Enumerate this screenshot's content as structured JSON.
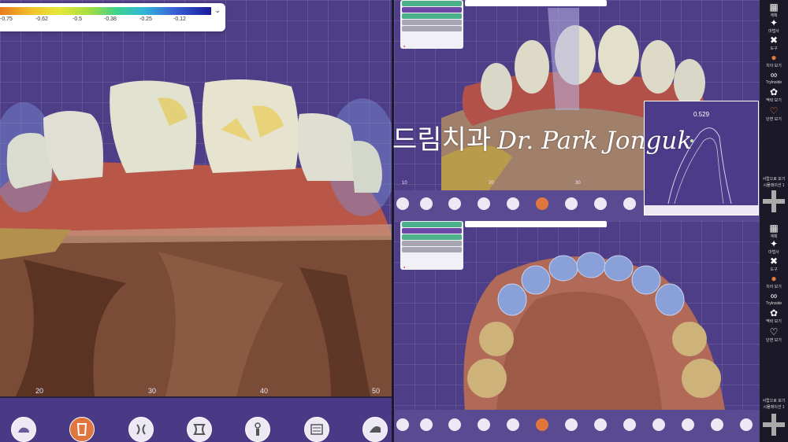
{
  "color_scale": {
    "ticks": [
      "-0.75",
      "-0.62",
      "-0.5",
      "-0.38",
      "-0.25",
      "-0.12"
    ]
  },
  "left_view": {
    "ruler_labels": [
      "20",
      "30",
      "40",
      "50"
    ]
  },
  "toolbar_main": {
    "buttons": [
      "image-icon",
      "crown-icon",
      "bracket-icon",
      "bracket-alt-icon",
      "implant-icon",
      "scanbody-icon",
      "scanner-icon"
    ]
  },
  "watermark": {
    "korean": "드림치과",
    "english": "Dr. Park Jonguk"
  },
  "inset": {
    "readout": "0.529"
  },
  "top_right": {
    "ruler_labels": [
      "10",
      "20",
      "30",
      "40"
    ]
  },
  "right_sidebar": {
    "items": [
      {
        "icon": "grid-icon",
        "label": "계획"
      },
      {
        "icon": "wand-icon",
        "label": "마법사"
      },
      {
        "icon": "tools-icon",
        "label": "도구"
      },
      {
        "icon": "tooth-icon",
        "label": "치아 보기"
      },
      {
        "icon": "tryin-icon",
        "label": "TryInside"
      },
      {
        "icon": "cluster-icon",
        "label": "맥락 보기"
      },
      {
        "icon": "tooth-outline-icon",
        "label": "단면 보기"
      }
    ],
    "nav_label": "서랍으로 보기",
    "page_label": "시뮬레이션 1"
  }
}
